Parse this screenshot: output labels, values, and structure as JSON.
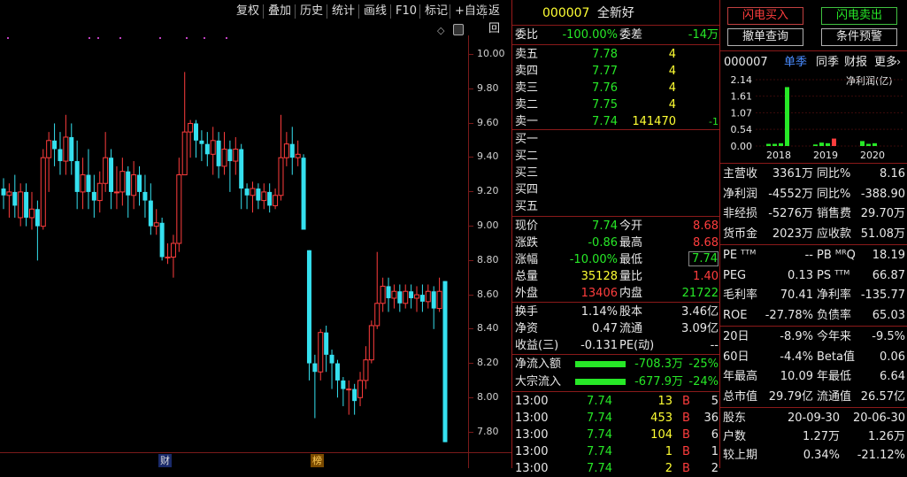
{
  "toolbar": {
    "items": [
      "复权",
      "叠加",
      "历史",
      "统计",
      "画线",
      "F10",
      "标记",
      "+自选",
      "返回"
    ]
  },
  "price_axis": [
    "10.00",
    "9.80",
    "9.60",
    "9.40",
    "9.20",
    "9.00",
    "8.80",
    "8.60",
    "8.40",
    "8.20",
    "8.00",
    "7.80"
  ],
  "markers": {
    "cai": "财",
    "bang": "榜"
  },
  "quote": {
    "code": "000007",
    "name": "全新好",
    "weibi_label": "委比",
    "weibi": "-100.00%",
    "weicha_label": "委差",
    "weicha": "-14万",
    "asks": [
      {
        "label": "卖五",
        "price": "7.78",
        "vol": "4",
        "chg": ""
      },
      {
        "label": "卖四",
        "price": "7.77",
        "vol": "4",
        "chg": ""
      },
      {
        "label": "卖三",
        "price": "7.76",
        "vol": "4",
        "chg": ""
      },
      {
        "label": "卖二",
        "price": "7.75",
        "vol": "4",
        "chg": ""
      },
      {
        "label": "卖一",
        "price": "7.74",
        "vol": "141470",
        "chg": "-1"
      }
    ],
    "bids": [
      {
        "label": "买一"
      },
      {
        "label": "买二"
      },
      {
        "label": "买三"
      },
      {
        "label": "买四"
      },
      {
        "label": "买五"
      }
    ],
    "stats": [
      {
        "l1": "现价",
        "v1": "7.74",
        "c1": "dn",
        "l2": "今开",
        "v2": "8.68",
        "c2": "up"
      },
      {
        "l1": "涨跌",
        "v1": "-0.86",
        "c1": "dn",
        "l2": "最高",
        "v2": "8.68",
        "c2": "up"
      },
      {
        "l1": "涨幅",
        "v1": "-10.00%",
        "c1": "dn",
        "l2": "最低",
        "v2": "7.74",
        "c2": "dn"
      },
      {
        "l1": "总量",
        "v1": "35128",
        "c1": "yl",
        "l2": "量比",
        "v2": "1.40",
        "c2": "up"
      },
      {
        "l1": "外盘",
        "v1": "13406",
        "c1": "up",
        "l2": "内盘",
        "v2": "21722",
        "c2": "dn"
      }
    ],
    "stats2": [
      {
        "l1": "换手",
        "v1": "1.14%",
        "l2": "股本",
        "v2": "3.46亿"
      },
      {
        "l1": "净资",
        "v1": "0.47",
        "l2": "流通",
        "v2": "3.09亿"
      },
      {
        "l1": "收益(三)",
        "v1": "-0.131",
        "l2": "PE(动)",
        "v2": "--"
      }
    ],
    "flows": [
      {
        "label": "净流入额",
        "amt": "-708.3万",
        "pct": "-25%"
      },
      {
        "label": "大宗流入",
        "amt": "-677.9万",
        "pct": "-24%"
      }
    ],
    "ticks": [
      {
        "t": "13:00",
        "p": "7.74",
        "v": "13",
        "bs": "B",
        "n": "5"
      },
      {
        "t": "13:00",
        "p": "7.74",
        "v": "453",
        "bs": "B",
        "n": "36"
      },
      {
        "t": "13:00",
        "p": "7.74",
        "v": "104",
        "bs": "B",
        "n": "6"
      },
      {
        "t": "13:00",
        "p": "7.74",
        "v": "1",
        "bs": "B",
        "n": "1"
      },
      {
        "t": "13:00",
        "p": "7.74",
        "v": "2",
        "bs": "B",
        "n": "2"
      }
    ]
  },
  "right": {
    "btn_buy": "闪电买入",
    "btn_sell": "闪电卖出",
    "btn_query": "撤单查询",
    "btn_cond": "条件预警",
    "code": "000007",
    "tabs": [
      "单季",
      "同季",
      "财报",
      "更多"
    ],
    "chart_unit": "净利润(亿)",
    "fin": [
      {
        "l1": "主营收",
        "v1": "3361万",
        "l2": "同比%",
        "v2": "8.16"
      },
      {
        "l1": "净利润",
        "v1": "-4552万",
        "l2": "同比%",
        "v2": "-388.90"
      },
      {
        "l1": "非经损",
        "v1": "-5276万",
        "l2": "销售费",
        "v2": "29.70万"
      },
      {
        "l1": "货币金",
        "v1": "2023万",
        "l2": "应收款",
        "v2": "51.08万"
      }
    ],
    "val": [
      {
        "l1": "PE ᵀᵀᴹ",
        "v1": "--",
        "l2": "PB ᴹᴿQ",
        "v2": "18.19"
      },
      {
        "l1": "PEG",
        "v1": "0.13",
        "l2": "PS ᵀᵀᴹ",
        "v2": "66.87"
      },
      {
        "l1": "毛利率",
        "v1": "70.41",
        "l2": "净利率",
        "v2": "-135.77"
      },
      {
        "l1": "ROE",
        "v1": "-27.78%",
        "l2": "负债率",
        "v2": "65.03"
      }
    ],
    "perf": [
      {
        "l1": "20日",
        "v1": "-8.9%",
        "l2": "今年来",
        "v2": "-9.5%"
      },
      {
        "l1": "60日",
        "v1": "-4.4%",
        "l2": "Beta值",
        "v2": "0.06"
      },
      {
        "l1": "年最高",
        "v1": "10.09",
        "l2": "年最低",
        "v2": "6.64"
      },
      {
        "l1": "总市值",
        "v1": "29.79亿",
        "l2": "流通值",
        "v2": "26.57亿"
      }
    ],
    "holders": [
      {
        "l": "股东",
        "a": "20-09-30",
        "b": "20-06-30"
      },
      {
        "l": "户数",
        "a": "1.27万",
        "b": "1.26万"
      },
      {
        "l": "较上期",
        "a": "0.34%",
        "b": "-21.12%"
      }
    ]
  },
  "chart_data": {
    "type": "bar",
    "ylabel": "净利润(亿)",
    "yticks": [
      "2.14",
      "1.61",
      "1.07",
      "0.54",
      "0.00"
    ],
    "ylim": [
      0,
      2.14
    ],
    "x_labels": [
      "2018",
      "2019",
      "2020"
    ],
    "bars": [
      {
        "year": "2018",
        "q": 1,
        "value": 0.07,
        "color": "#27e827"
      },
      {
        "year": "2018",
        "q": 2,
        "value": 0.07,
        "color": "#27e827"
      },
      {
        "year": "2018",
        "q": 3,
        "value": 0.09,
        "color": "#27e827"
      },
      {
        "year": "2018",
        "q": 4,
        "value": 1.9,
        "color": "#27e827"
      },
      {
        "year": "2019",
        "q": 1,
        "value": 0.05,
        "color": "#27e827"
      },
      {
        "year": "2019",
        "q": 2,
        "value": 0.11,
        "color": "#27e827"
      },
      {
        "year": "2019",
        "q": 3,
        "value": 0.09,
        "color": "#27e827"
      },
      {
        "year": "2019",
        "q": 4,
        "value": 0.24,
        "color": "#ff3d3d"
      },
      {
        "year": "2020",
        "q": 1,
        "value": 0.16,
        "color": "#27e827"
      },
      {
        "year": "2020",
        "q": 2,
        "value": 0.07,
        "color": "#27e827"
      },
      {
        "year": "2020",
        "q": 3,
        "value": 0.09,
        "color": "#27e827"
      }
    ]
  }
}
